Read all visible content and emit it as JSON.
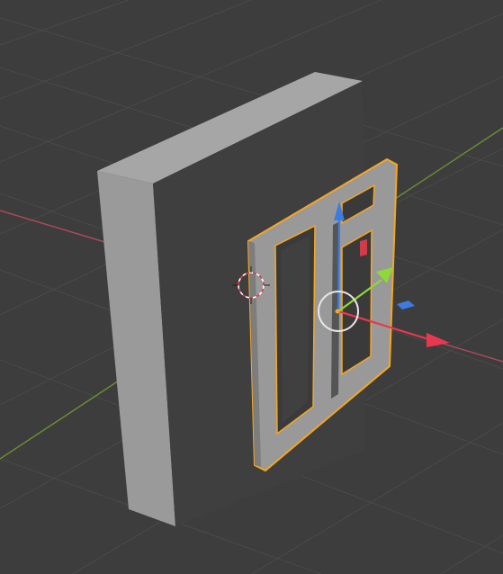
{
  "viewport": {
    "mode": "3d-viewport",
    "background_color": "#3d3d3d",
    "grid_line_color": "#4a4a4a"
  },
  "axes": {
    "x_axis_color": "#b34a5a",
    "y_axis_color": "#6b8f35"
  },
  "objects": [
    {
      "name": "wall",
      "selected": false,
      "color_front": "#999999",
      "color_side": "#3f3f3f"
    },
    {
      "name": "door-frame",
      "selected": true,
      "outline_color": "#f5a623",
      "color_face": "#999999",
      "color_inset": "#3a3a3a"
    }
  ],
  "gizmos": {
    "z_arrow_color": "#3d7be0",
    "x_arrow_color": "#e8384f",
    "y_arrow_color": "#8ed837",
    "x_handle_color": "#d33a4a",
    "y_plane_handle_color": "#3d7be0",
    "origin_color": "#f5a623"
  },
  "cursor_3d": {
    "colors": [
      "#ffffff",
      "#e8384f"
    ]
  }
}
